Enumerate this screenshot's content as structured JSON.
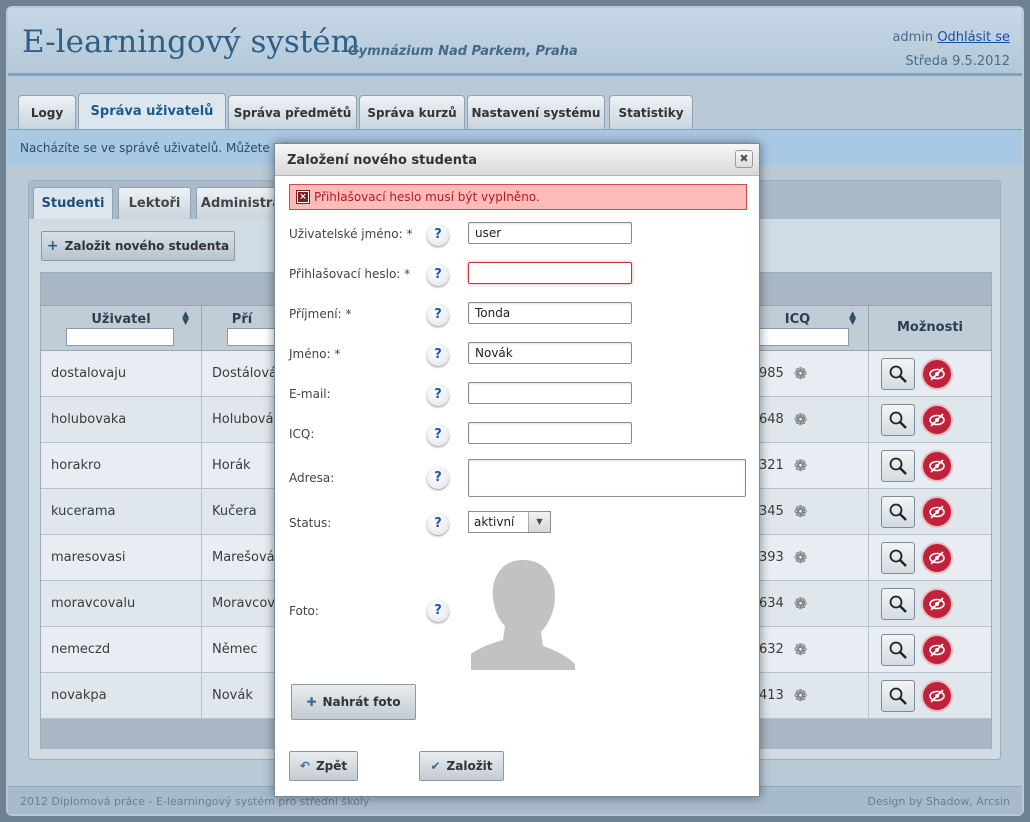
{
  "header": {
    "title": "E-learningový systém",
    "subtitle": "Gymnázium Nad Parkem, Praha",
    "user": "admin",
    "logout": "Odhlásit se",
    "date": "Středa 9.5.2012"
  },
  "main_tabs": [
    "Logy",
    "Správa uživatelů",
    "Správa předmětů",
    "Správa kurzů",
    "Nastavení systému",
    "Statistiky"
  ],
  "info_text": "Nacházíte se ve správě uživatelů. Můžete zd",
  "sub_tabs": [
    "Studenti",
    "Lektoři",
    "Administra"
  ],
  "add_button": "Založit nového studenta",
  "columns": {
    "user": "Uživatel",
    "surname": "Pří",
    "icq": "ICQ",
    "options": "Možnosti"
  },
  "rows": [
    {
      "user": "dostalovaju",
      "surname": "Dostálová",
      "icq": "985"
    },
    {
      "user": "holubovaka",
      "surname": "Holubová",
      "icq": "648"
    },
    {
      "user": "horakro",
      "surname": "Horák",
      "icq": "321"
    },
    {
      "user": "kucerama",
      "surname": "Kučera",
      "icq": "345"
    },
    {
      "user": "maresovasi",
      "surname": "Marešová",
      "icq": "393"
    },
    {
      "user": "moravcovalu",
      "surname": "Moravcová",
      "icq": "634"
    },
    {
      "user": "nemeczd",
      "surname": "Němec",
      "icq": "632"
    },
    {
      "user": "novakpa",
      "surname": "Novák",
      "icq": "413"
    }
  ],
  "footer": {
    "left": "2012 Diplomová práce - E-learningový systém pro střední školy",
    "right": "Design by Shadow, Arcsin"
  },
  "dialog": {
    "title": "Založení nového studenta",
    "close": "✖",
    "error": "Přihlašovací heslo musí být vyplněno.",
    "help": "?",
    "fields": {
      "username": {
        "label": "Uživatelské jméno: *",
        "value": "user"
      },
      "password": {
        "label": "Přihlašovací heslo: *",
        "value": ""
      },
      "surname": {
        "label": "Příjmení: *",
        "value": "Tonda"
      },
      "name": {
        "label": "Jméno: *",
        "value": "Novák"
      },
      "email": {
        "label": "E-mail:",
        "value": ""
      },
      "icq": {
        "label": "ICQ:",
        "value": ""
      },
      "address": {
        "label": "Adresa:",
        "value": ""
      },
      "status": {
        "label": "Status:",
        "value": "aktivní"
      },
      "photo": {
        "label": "Foto:"
      }
    },
    "upload_button": "Nahrát foto",
    "back_button": "Zpět",
    "create_button": "Založit"
  }
}
